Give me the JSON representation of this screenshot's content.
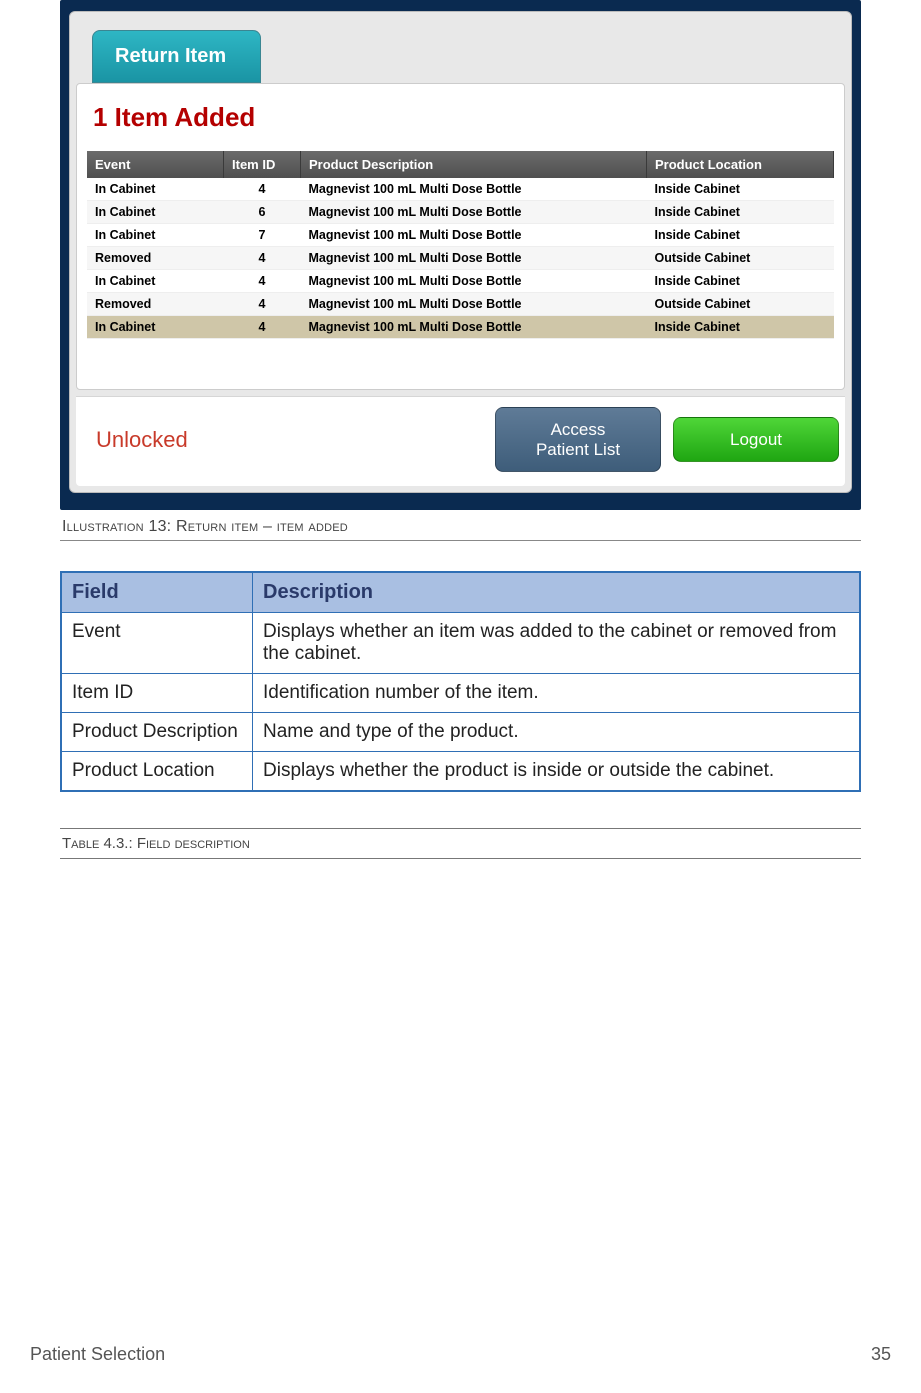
{
  "screenshot": {
    "tab_title": "Return Item",
    "banner": "1 Item Added",
    "columns": {
      "event": "Event",
      "item_id": "Item ID",
      "product_desc": "Product Description",
      "product_loc": "Product Location"
    },
    "rows": [
      {
        "event": "In Cabinet",
        "id": "4",
        "desc": "Magnevist 100 mL Multi Dose Bottle",
        "loc": "Inside Cabinet"
      },
      {
        "event": "In Cabinet",
        "id": "6",
        "desc": "Magnevist 100 mL Multi Dose Bottle",
        "loc": "Inside Cabinet"
      },
      {
        "event": "In Cabinet",
        "id": "7",
        "desc": "Magnevist 100 mL Multi Dose Bottle",
        "loc": "Inside Cabinet"
      },
      {
        "event": "Removed",
        "id": "4",
        "desc": "Magnevist 100 mL Multi Dose Bottle",
        "loc": "Outside Cabinet"
      },
      {
        "event": "In Cabinet",
        "id": "4",
        "desc": "Magnevist 100 mL Multi Dose Bottle",
        "loc": "Inside Cabinet"
      },
      {
        "event": "Removed",
        "id": "4",
        "desc": "Magnevist 100 mL Multi Dose Bottle",
        "loc": "Outside Cabinet"
      },
      {
        "event": "In Cabinet",
        "id": "4",
        "desc": "Magnevist 100 mL Multi Dose Bottle",
        "loc": "Inside Cabinet",
        "highlight": true
      }
    ],
    "unlocked_label": "Unlocked",
    "access_button": "Access\nPatient List",
    "logout_button": "Logout"
  },
  "illustration_caption": "Illustration 13: Return item – item added",
  "field_table": {
    "header_field": "Field",
    "header_desc": "Description",
    "rows": [
      {
        "field": "Event",
        "desc": "Displays whether an item was added to the cabinet or removed from the cabinet."
      },
      {
        "field": "Item ID",
        "desc": "Identification number of the item."
      },
      {
        "field": "Product Description",
        "desc": "Name and type of the product."
      },
      {
        "field": "Product Location",
        "desc": "Displays whether the product is inside or outside the cabinet."
      }
    ]
  },
  "table_caption": "Table 4.3.: Field description",
  "footer_left": "Patient Selection",
  "footer_right": "35"
}
